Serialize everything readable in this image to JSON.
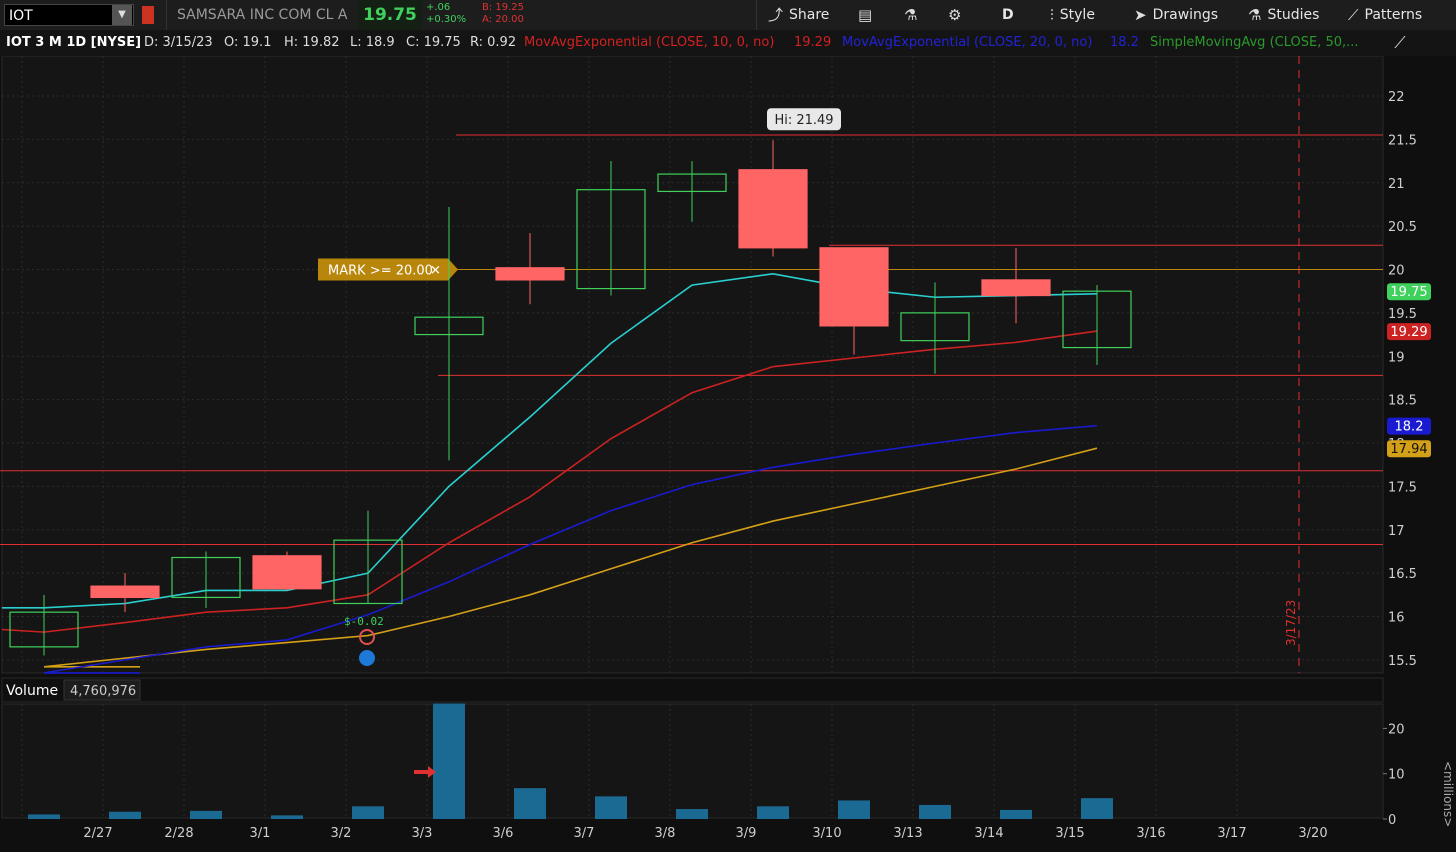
{
  "toolbar": {
    "symbol": "IOT",
    "company": "SAMSARA INC COM CL A",
    "last": "19.75",
    "change": "+.06",
    "change_pct": "+0.30%",
    "bid": "B: 19.25",
    "ask": "A: 20.00",
    "share_label": "Share",
    "timeframe": "D",
    "style_label": "Style",
    "drawings_label": "Drawings",
    "studies_label": "Studies",
    "patterns_label": "Patterns"
  },
  "status": {
    "title": "IOT 3 M 1D [NYSE]",
    "date": "D: 3/15/23",
    "open": "O: 19.1",
    "high": "H: 19.82",
    "low": "L: 18.9",
    "close": "C: 19.75",
    "range": "R: 0.92",
    "study1": "MovAvgExponential (CLOSE, 10, 0, no)",
    "study1_val": "19.29",
    "study2": "MovAvgExponential (CLOSE, 20, 0, no)",
    "study2_val": "18.2",
    "study3": "SimpleMovingAvg (CLOSE, 50,..."
  },
  "colors": {
    "up": "#3fd15c",
    "down": "#ff6565",
    "ema10": "#cc2222",
    "ema20": "#1a1ad0",
    "sma50": "#d4a017",
    "extra_line": "#2ad0d0",
    "level": "#e03030",
    "alert": "#b8860b",
    "volume": "#1b6a94"
  },
  "chart_data": {
    "type": "candlestick",
    "price_axis": {
      "min": 15.5,
      "max": 22,
      "ticks": [
        "15.5",
        "16",
        "16.5",
        "17",
        "17.5",
        "18",
        "18.5",
        "19",
        "19.5",
        "20",
        "20.5",
        "21",
        "21.5",
        "22"
      ]
    },
    "x_labels": [
      "2/27",
      "2/28",
      "3/1",
      "3/2",
      "3/3",
      "3/6",
      "3/7",
      "3/8",
      "3/9",
      "3/10",
      "3/13",
      "3/14",
      "3/15",
      "3/16",
      "3/17",
      "3/20"
    ],
    "candles": [
      {
        "open": 15.65,
        "high": 16.25,
        "low": 15.55,
        "close": 16.05
      },
      {
        "open": 16.35,
        "high": 16.5,
        "low": 16.05,
        "close": 16.22
      },
      {
        "open": 16.22,
        "high": 16.75,
        "low": 16.1,
        "close": 16.68
      },
      {
        "open": 16.7,
        "high": 16.75,
        "low": 16.3,
        "close": 16.32
      },
      {
        "open": 16.15,
        "high": 17.22,
        "low": 16.15,
        "close": 16.88
      },
      {
        "open": 19.25,
        "high": 20.72,
        "low": 17.8,
        "close": 19.45
      },
      {
        "open": 20.02,
        "high": 20.42,
        "low": 19.6,
        "close": 19.88
      },
      {
        "open": 19.78,
        "high": 21.25,
        "low": 19.7,
        "close": 20.92
      },
      {
        "open": 20.9,
        "high": 21.25,
        "low": 20.55,
        "close": 21.1
      },
      {
        "open": 21.15,
        "high": 21.49,
        "low": 20.15,
        "close": 20.25
      },
      {
        "open": 20.25,
        "high": 20.25,
        "low": 19.02,
        "close": 19.35
      },
      {
        "open": 19.18,
        "high": 19.85,
        "low": 18.8,
        "close": 19.5
      },
      {
        "open": 19.88,
        "high": 20.25,
        "low": 19.38,
        "close": 19.7
      },
      {
        "open": 19.1,
        "high": 19.82,
        "low": 18.9,
        "close": 19.75
      }
    ],
    "ema10": [
      15.82,
      15.93,
      16.05,
      16.1,
      16.25,
      16.85,
      17.38,
      18.05,
      18.58,
      18.88,
      18.98,
      19.08,
      19.16,
      19.29
    ],
    "ema20": [
      15.35,
      15.5,
      15.65,
      15.73,
      16.02,
      16.4,
      16.83,
      17.22,
      17.52,
      17.72,
      17.87,
      18.0,
      18.12,
      18.2
    ],
    "sma50": [
      15.42,
      15.52,
      15.62,
      15.7,
      15.78,
      16.0,
      16.25,
      16.55,
      16.85,
      17.1,
      17.3,
      17.5,
      17.7,
      17.94
    ],
    "fast_line": [
      16.1,
      16.15,
      16.3,
      16.3,
      16.5,
      17.5,
      18.3,
      19.15,
      19.82,
      19.95,
      19.78,
      19.68,
      19.7,
      19.72
    ],
    "volume_millions": [
      1.0,
      1.6,
      1.8,
      0.8,
      2.8,
      25.5,
      6.8,
      5.0,
      2.2,
      2.8,
      4.1,
      3.1,
      2.0,
      4.6
    ],
    "volume_axis": {
      "max": 25.5,
      "ticks": [
        "0",
        "10",
        "20"
      ],
      "label": "<millions>"
    },
    "volume_label": "Volume",
    "volume_value": "4,760,976",
    "levels": [
      21.55,
      20.28,
      18.78,
      17.68,
      16.83
    ],
    "alert": {
      "label": "MARK >= 20.00",
      "price": 20.0
    },
    "hi_label": "Hi: 21.49",
    "dividend_label": "$-0.02",
    "earnings_date": "3/17/23",
    "price_labels": {
      "last": "19.75",
      "ema10": "19.29",
      "ema20": "18.2",
      "sma50": "17.94"
    }
  }
}
